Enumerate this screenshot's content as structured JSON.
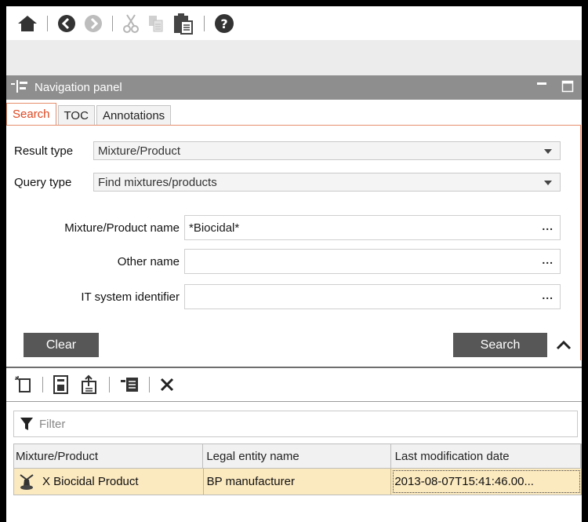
{
  "toolbar": {
    "icons": [
      "home-icon",
      "back-icon",
      "forward-icon",
      "cut-icon",
      "copy-icon",
      "paste-icon",
      "help-icon"
    ]
  },
  "nav_panel": {
    "title": "Navigation panel",
    "tabs": [
      {
        "label": "Search",
        "active": true
      },
      {
        "label": "TOC",
        "active": false
      },
      {
        "label": "Annotations",
        "active": false
      }
    ]
  },
  "search_form": {
    "result_type": {
      "label": "Result type",
      "value": "Mixture/Product"
    },
    "query_type": {
      "label": "Query type",
      "value": "Find mixtures/products"
    },
    "fields": [
      {
        "label": "Mixture/Product name",
        "value": "*Biocidal*",
        "action": "..."
      },
      {
        "label": "Other name",
        "value": "",
        "action": "..."
      },
      {
        "label": "IT system identifier",
        "value": "",
        "action": "..."
      }
    ],
    "clear_label": "Clear",
    "search_label": "Search"
  },
  "filter": {
    "placeholder": "Filter"
  },
  "table": {
    "columns": [
      "Mixture/Product",
      "Legal entity name",
      "Last modification date"
    ],
    "rows": [
      {
        "product": "X Biocidal Product",
        "legal_entity": "BP manufacturer",
        "modified": "2013-08-07T15:41:46.00..."
      }
    ]
  },
  "colors": {
    "accent": "#e0451f",
    "header": "#8e8e8e",
    "button": "#575757",
    "selected_row": "#fbe9bf"
  }
}
